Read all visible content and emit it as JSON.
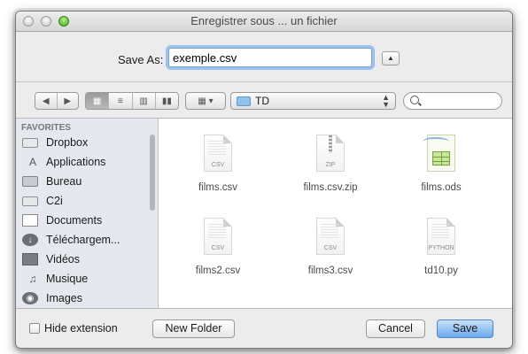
{
  "window": {
    "title": "Enregistrer sous ... un fichier"
  },
  "save": {
    "label": "Save As:",
    "filename": "exemple.csv"
  },
  "toolbar": {
    "nav_back_glyph": "◀",
    "nav_forward_glyph": "▶",
    "folder": "TD",
    "search_value": "",
    "arrows_glyph": "⇕",
    "arrange_glyph": "▾"
  },
  "sidebar": {
    "header": "FAVORITES",
    "items": [
      {
        "label": "Dropbox",
        "icon": "folder-icon"
      },
      {
        "label": "Applications",
        "icon": "applications-icon"
      },
      {
        "label": "Bureau",
        "icon": "desktop-icon"
      },
      {
        "label": "C2i",
        "icon": "folder-icon"
      },
      {
        "label": "Documents",
        "icon": "documents-icon"
      },
      {
        "label": "Téléchargem...",
        "icon": "downloads-icon"
      },
      {
        "label": "Vidéos",
        "icon": "movies-icon"
      },
      {
        "label": "Musique",
        "icon": "music-icon"
      },
      {
        "label": "Images",
        "icon": "pictures-icon"
      }
    ]
  },
  "files": [
    {
      "name": "films.csv",
      "tag": "CSV"
    },
    {
      "name": "films.csv.zip",
      "tag": "ZIP"
    },
    {
      "name": "films.ods",
      "tag": ""
    },
    {
      "name": "films2.csv",
      "tag": "CSV"
    },
    {
      "name": "films3.csv",
      "tag": "CSV"
    },
    {
      "name": "td10.py",
      "tag": "PYTHON"
    }
  ],
  "bottom": {
    "hide_extension": "Hide extension",
    "new_folder": "New Folder",
    "cancel": "Cancel",
    "save": "Save"
  },
  "colors": {
    "accent": "#6aaaee",
    "focus_ring": "#9cc3f0",
    "sidebar_bg": "#e5e9ef"
  }
}
